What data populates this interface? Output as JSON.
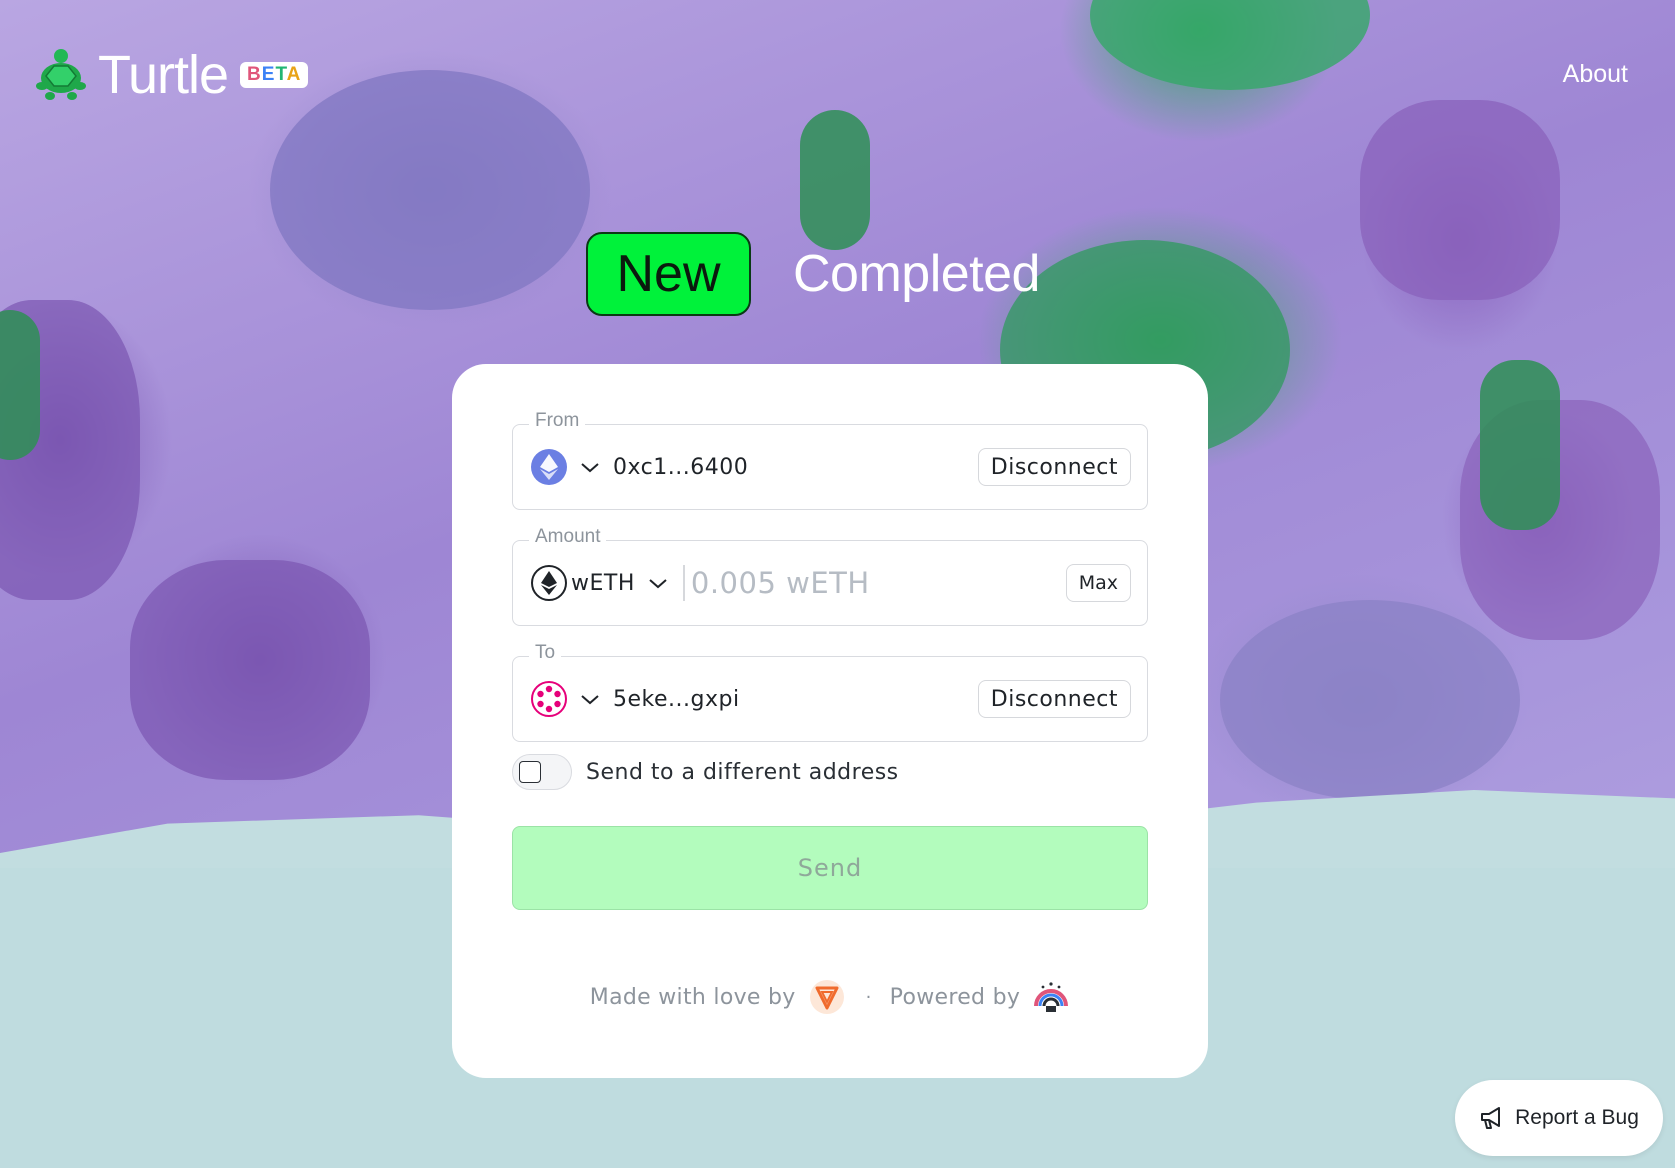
{
  "header": {
    "brand": "Turtle",
    "beta_letters": [
      "B",
      "E",
      "T",
      "A"
    ],
    "about_label": "About"
  },
  "tabs": {
    "new_label": "New",
    "completed_label": "Completed"
  },
  "transfer": {
    "from": {
      "legend": "From",
      "chain_icon": "ethereum-icon",
      "address": "0xc1...6400",
      "disconnect_label": "Disconnect"
    },
    "amount": {
      "legend": "Amount",
      "token_icon": "weth-icon",
      "token": "wETH",
      "placeholder": "0.005 wETH",
      "max_label": "Max"
    },
    "to": {
      "legend": "To",
      "chain_icon": "polkadot-icon",
      "address": "5eke...gxpi",
      "disconnect_label": "Disconnect"
    },
    "different_address_label": "Send to a different address",
    "send_label": "Send"
  },
  "footer": {
    "made_with_love": "Made with love by",
    "separator": "·",
    "powered_by": "Powered by"
  },
  "report_bug_label": "Report a Bug",
  "colors": {
    "accent_green": "#00f23a",
    "send_disabled": "#b3fcbd",
    "card_bg": "#ffffff"
  }
}
